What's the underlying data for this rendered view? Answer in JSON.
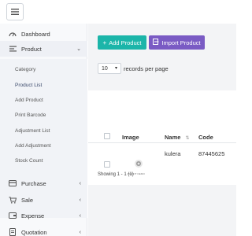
{
  "sidebar": {
    "dashboard_label": "Dashboard",
    "product_label": "Product",
    "product_submenu": [
      "Category",
      "Product List",
      "Add Product",
      "Print Barcode",
      "Adjustment List",
      "Add Adjustment",
      "Stock Count"
    ],
    "purchase_label": "Purchase",
    "sale_label": "Sale",
    "expense_label": "Expense",
    "quotation_label": "Quotation"
  },
  "toolbar": {
    "add_product_label": "Add Product",
    "add_icon": "plus-icon",
    "import_product_label": "Import Product",
    "import_icon": "file-import-icon"
  },
  "records": {
    "selected_value": "10",
    "suffix": "records per page"
  },
  "table": {
    "columns": [
      "Image",
      "Name",
      "Code"
    ],
    "rows": [
      {
        "image_caption": "PROFIT DEMO",
        "name": "kulera",
        "code": "87445625"
      }
    ],
    "showing": "Showing 1 - 1 (1)"
  },
  "colors": {
    "add_button": "#1bb5a9",
    "import_button": "#7a5bc4",
    "sidebar_bg": "#f8f9fb",
    "main_bg": "#f3f4f6"
  }
}
